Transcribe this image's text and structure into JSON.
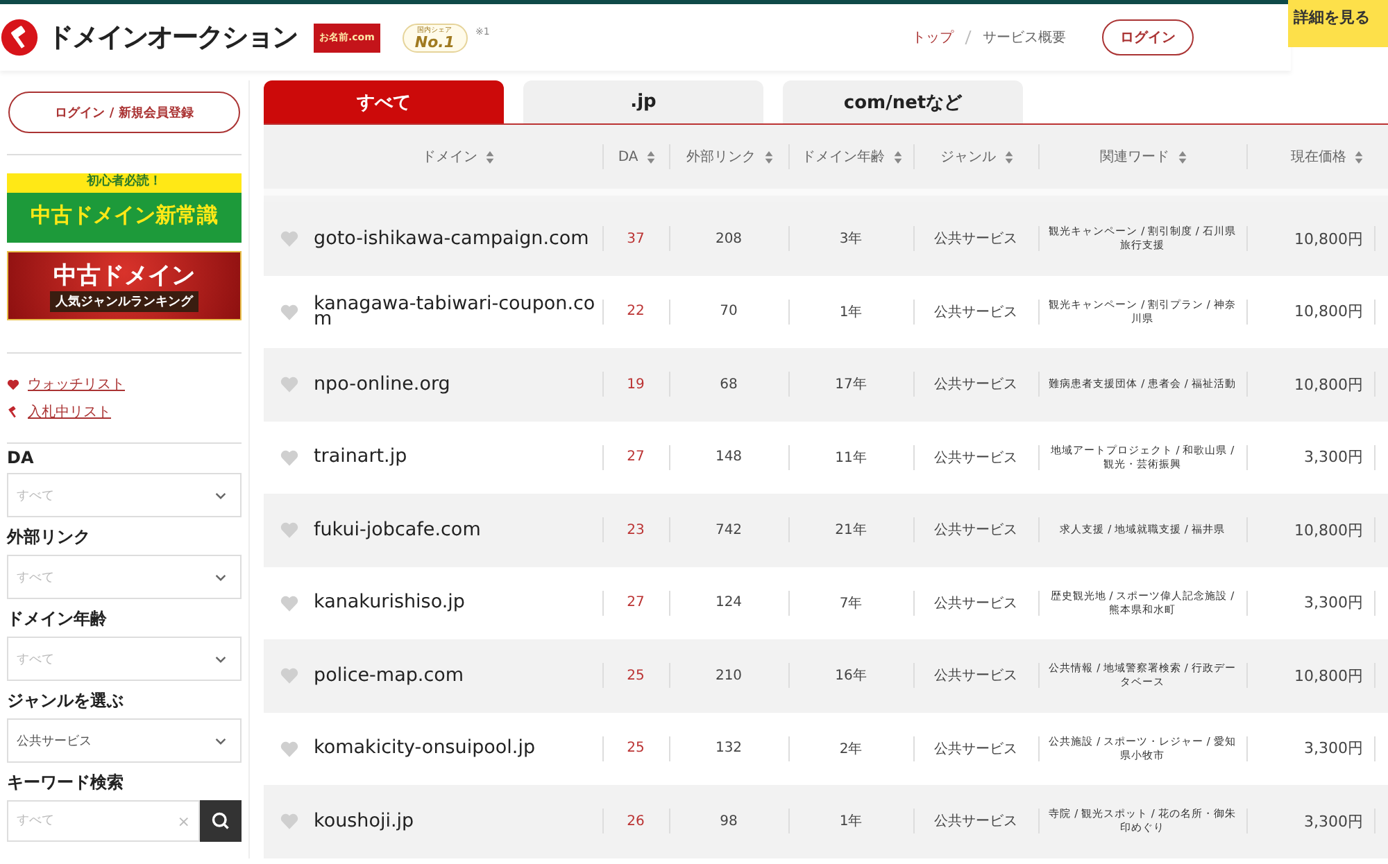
{
  "header": {
    "logo": "ドメインオークション",
    "partner_badge": "お名前.com",
    "share_badge": {
      "caption": "国内シェア",
      "title": "No.1",
      "note": "※1"
    },
    "nav": [
      "トップ",
      "サービス概要"
    ],
    "login": "ログイン",
    "details_tab": "詳細を見る"
  },
  "sidebar": {
    "account_button": "ログイン / 新規会員登録",
    "banners": [
      {
        "kind": "green",
        "top": "初心者必読！",
        "main": "中古ドメイン新常識"
      },
      {
        "kind": "red",
        "top": "中古ドメイン",
        "main": "人気ジャンルランキング"
      }
    ],
    "links": [
      {
        "kind": "heart",
        "label": "ウォッチリスト"
      },
      {
        "kind": "gavel",
        "label": "入札中リスト"
      }
    ],
    "filters": [
      {
        "kind": "select",
        "label": "DA",
        "placeholder": "すべて"
      },
      {
        "kind": "select",
        "label": "外部リンク",
        "placeholder": "すべて"
      },
      {
        "kind": "select",
        "label": "ドメイン年齢",
        "placeholder": "すべて"
      },
      {
        "kind": "select",
        "label": "ジャンルを選ぶ",
        "value": "公共サービス"
      },
      {
        "kind": "search",
        "label": "キーワード検索",
        "placeholder": "すべて",
        "clear": "×"
      }
    ]
  },
  "tabs": [
    {
      "label": "すべて",
      "selected": true
    },
    {
      "label": ".jp",
      "selected": false
    },
    {
      "label": "com/netなど",
      "selected": false
    }
  ],
  "table": {
    "columns": [
      "ドメイン",
      "DA",
      "外部リンク",
      "ドメイン年齢",
      "ジャンル",
      "関連ワード",
      "現在価格"
    ],
    "rows": [
      {
        "watched": false,
        "domain": "goto-ishikawa-campaign.com",
        "da": "37",
        "links": "208",
        "age": "3年",
        "genre": "公共サービス",
        "words": "観光キャンペーン / 割引制度 / 石川県旅行支援",
        "price": "10,800円"
      },
      {
        "watched": false,
        "domain": "kanagawa-tabiwari-coupon.com",
        "da": "22",
        "links": "70",
        "age": "1年",
        "genre": "公共サービス",
        "words": "観光キャンペーン / 割引プラン / 神奈川県",
        "price": "10,800円"
      },
      {
        "watched": false,
        "domain": "npo-online.org",
        "da": "19",
        "links": "68",
        "age": "17年",
        "genre": "公共サービス",
        "words": "難病患者支援団体 / 患者会 / 福祉活動",
        "price": "10,800円"
      },
      {
        "watched": false,
        "domain": "trainart.jp",
        "da": "27",
        "links": "148",
        "age": "11年",
        "genre": "公共サービス",
        "words": "地域アートプロジェクト / 和歌山県 / 観光・芸術振興",
        "price": "3,300円"
      },
      {
        "watched": false,
        "domain": "fukui-jobcafe.com",
        "da": "23",
        "links": "742",
        "age": "21年",
        "genre": "公共サービス",
        "words": "求人支援 / 地域就職支援 / 福井県",
        "price": "10,800円"
      },
      {
        "watched": false,
        "domain": "kanakurishiso.jp",
        "da": "27",
        "links": "124",
        "age": "7年",
        "genre": "公共サービス",
        "words": "歴史観光地 / スポーツ偉人記念施設 / 熊本県和水町",
        "price": "3,300円"
      },
      {
        "watched": false,
        "domain": "police-map.com",
        "da": "25",
        "links": "210",
        "age": "16年",
        "genre": "公共サービス",
        "words": "公共情報 / 地域警察署検索 / 行政データベース",
        "price": "10,800円"
      },
      {
        "watched": false,
        "domain": "komakicity-onsuipool.jp",
        "da": "25",
        "links": "132",
        "age": "2年",
        "genre": "公共サービス",
        "words": "公共施設 / スポーツ・レジャー / 愛知県小牧市",
        "price": "3,300円"
      },
      {
        "watched": false,
        "domain": "koushoji.jp",
        "da": "26",
        "links": "98",
        "age": "1年",
        "genre": "公共サービス",
        "words": "寺院 / 観光スポット / 花の名所・御朱印めぐり",
        "price": "3,300円"
      }
    ]
  }
}
